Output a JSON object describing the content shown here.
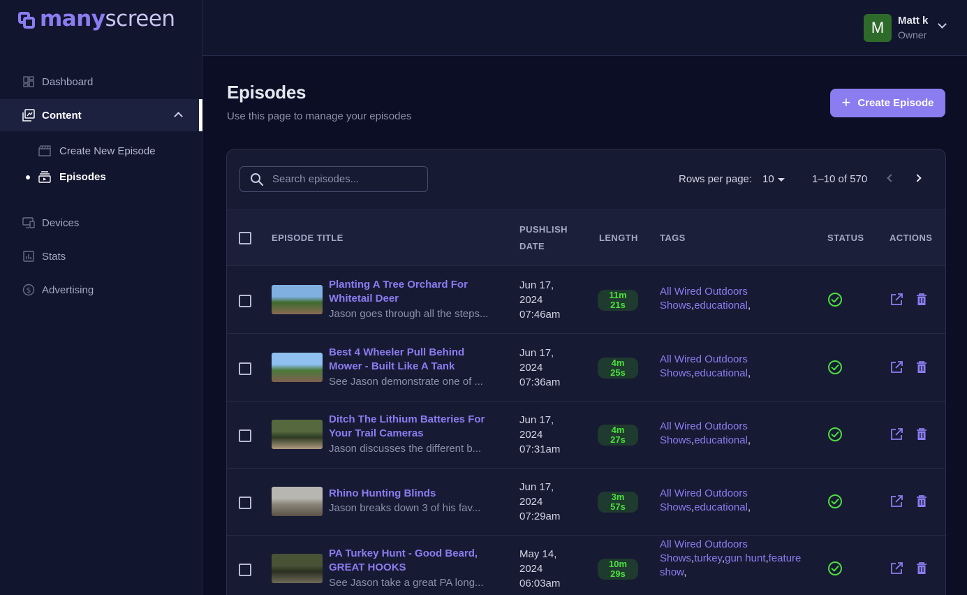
{
  "app": {
    "logo_bold": "many",
    "logo_light": "screen"
  },
  "sidebar": {
    "items": [
      {
        "label": "Dashboard",
        "icon": "dashboard-icon"
      },
      {
        "label": "Content",
        "icon": "content-icon"
      },
      {
        "label": "Devices",
        "icon": "devices-icon"
      },
      {
        "label": "Stats",
        "icon": "stats-icon"
      },
      {
        "label": "Advertising",
        "icon": "advertising-icon"
      }
    ],
    "content_sub": [
      {
        "label": "Create New Episode",
        "icon": "clapperboard-icon"
      },
      {
        "label": "Episodes",
        "icon": "episodes-icon"
      }
    ]
  },
  "user": {
    "initial": "M",
    "name": "Matt k",
    "role": "Owner"
  },
  "page": {
    "title": "Episodes",
    "subtitle": "Use this page to manage your episodes",
    "create_button": "Create Episode"
  },
  "table": {
    "search_placeholder": "Search episodes...",
    "rows_per_page_label": "Rows per page:",
    "rows_per_page_value": "10",
    "range_text": "1–10 of 570",
    "headers": {
      "title": "EPISODE TITLE",
      "publish_1": "PUSHLISH",
      "publish_2": "DATE",
      "length": "LENGTH",
      "tags": "TAGS",
      "status": "STATUS",
      "actions": "ACTIONS"
    },
    "rows": [
      {
        "title": "Planting A Tree Orchard For Whitetail Deer",
        "desc": "Jason goes through all the steps...",
        "date": "Jun 17,",
        "year": "2024",
        "time": "07:46am",
        "len_1": "11m",
        "len_2": "21s",
        "tags": [
          "All Wired Outdoors Shows",
          "educational"
        ],
        "status": "published",
        "thumb_colors": [
          "#7fb0e0",
          "#3f6a2c",
          "#8a6a55"
        ]
      },
      {
        "title": "Best 4 Wheeler Pull Behind Mower - Built Like A Tank",
        "desc": "See Jason demonstrate one of ...",
        "date": "Jun 17,",
        "year": "2024",
        "time": "07:36am",
        "len_1": "4m",
        "len_2": "25s",
        "tags": [
          "All Wired Outdoors Shows",
          "educational"
        ],
        "status": "published",
        "thumb_colors": [
          "#8fc0f0",
          "#4a7a3a",
          "#806050"
        ]
      },
      {
        "title": "Ditch The Lithium Batteries For Your Trail Cameras",
        "desc": "Jason discusses the different b...",
        "date": "Jun 17,",
        "year": "2024",
        "time": "07:31am",
        "len_1": "4m",
        "len_2": "27s",
        "tags": [
          "All Wired Outdoors Shows",
          "educational"
        ],
        "status": "published",
        "thumb_colors": [
          "#55683e",
          "#2e3a22",
          "#b09a80"
        ]
      },
      {
        "title": "Rhino Hunting Blinds",
        "desc": "Jason breaks down 3 of his fav...",
        "date": "Jun 17,",
        "year": "2024",
        "time": "07:29am",
        "len_1": "3m",
        "len_2": "57s",
        "tags": [
          "All Wired Outdoors Shows",
          "educational"
        ],
        "status": "published",
        "thumb_colors": [
          "#b8b6b0",
          "#8a8478",
          "#5a5246"
        ]
      },
      {
        "title": "PA Turkey Hunt - Good Beard, GREAT HOOKS",
        "desc": "See Jason take a great PA long...",
        "date": "May 14,",
        "year": "2024",
        "time": "06:03am",
        "len_1": "10m",
        "len_2": "29s",
        "tags": [
          "All Wired Outdoors Shows",
          "turkey",
          "gun hunt",
          "feature show"
        ],
        "status": "published",
        "thumb_colors": [
          "#4a5236",
          "#2a3020",
          "#6e6a58"
        ]
      }
    ]
  }
}
